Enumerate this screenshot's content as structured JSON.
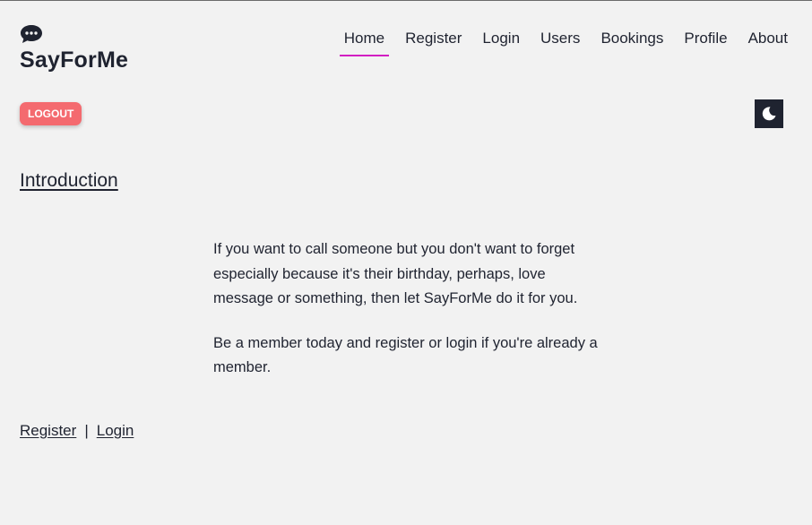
{
  "brand": {
    "icon": "speech-bubble-icon",
    "name": "SayForMe"
  },
  "nav": {
    "items": [
      {
        "label": "Home",
        "active": true
      },
      {
        "label": "Register",
        "active": false
      },
      {
        "label": "Login",
        "active": false
      },
      {
        "label": "Users",
        "active": false
      },
      {
        "label": "Bookings",
        "active": false
      },
      {
        "label": "Profile",
        "active": false
      },
      {
        "label": "About",
        "active": false
      }
    ],
    "active_indicator_color": "#d21ec2"
  },
  "actions": {
    "logout_label": "LOGOUT",
    "logout_color": "#f46a6f",
    "theme_toggle_icon": "moon-icon"
  },
  "main": {
    "heading": "Introduction",
    "paragraphs": [
      "If you want to call someone but you don't want to forget especially because it's their birthday, perhaps, love message or something, then let SayForMe do it for you.",
      "Be a member today and register or login if you're already a member."
    ]
  },
  "footer": {
    "register_label": "Register",
    "separator": "|",
    "login_label": "Login"
  },
  "colors": {
    "background": "#f2f2f2",
    "text": "#1f2330"
  }
}
